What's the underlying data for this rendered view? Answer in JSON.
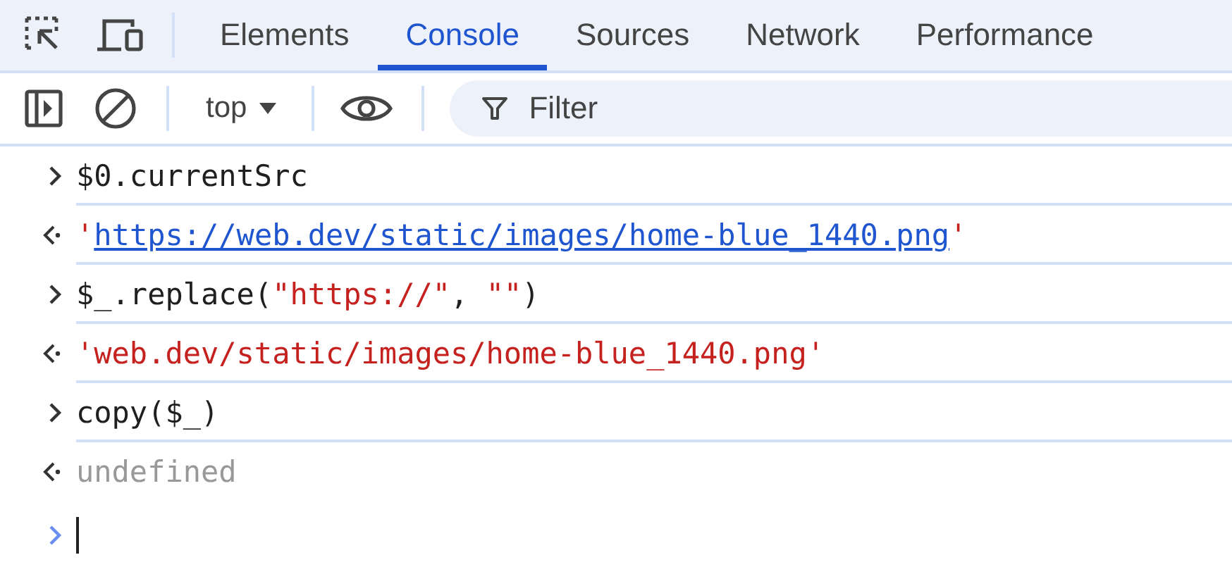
{
  "tabs": [
    {
      "label": "Elements",
      "selected": false
    },
    {
      "label": "Console",
      "selected": true
    },
    {
      "label": "Sources",
      "selected": false
    },
    {
      "label": "Network",
      "selected": false
    },
    {
      "label": "Performance",
      "selected": false
    }
  ],
  "toolbar": {
    "context": "top",
    "filter": {
      "placeholder": "Filter"
    }
  },
  "console": [
    {
      "kind": "input",
      "parts": [
        {
          "text": "$0.currentSrc",
          "kind": "code"
        }
      ]
    },
    {
      "kind": "output",
      "parts": [
        {
          "text": "'",
          "kind": "string"
        },
        {
          "text": "https://web.dev/static/images/home-blue_1440.png",
          "kind": "link"
        },
        {
          "text": "'",
          "kind": "string"
        }
      ]
    },
    {
      "kind": "input",
      "parts": [
        {
          "text": "$_.replace(",
          "kind": "code"
        },
        {
          "text": "\"https://\"",
          "kind": "string"
        },
        {
          "text": ", ",
          "kind": "code"
        },
        {
          "text": "\"\"",
          "kind": "string"
        },
        {
          "text": ")",
          "kind": "code"
        }
      ]
    },
    {
      "kind": "output",
      "parts": [
        {
          "text": "'web.dev/static/images/home-blue_1440.png'",
          "kind": "string"
        }
      ]
    },
    {
      "kind": "input",
      "parts": [
        {
          "text": "copy($_)",
          "kind": "code"
        }
      ]
    },
    {
      "kind": "output",
      "parts": [
        {
          "text": "undefined",
          "kind": "muted"
        }
      ]
    }
  ]
}
